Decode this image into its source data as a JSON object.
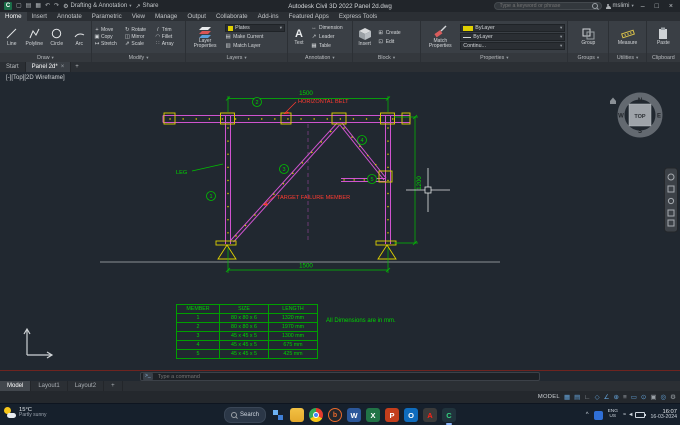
{
  "titlebar": {
    "app_title": "Autodesk Civil 3D 2022   Panel 2d.dwg",
    "workspace": "Drafting & Annotation",
    "share_label": "Share",
    "search_placeholder": "Type a keyword or phrase",
    "username": "mslimi"
  },
  "ribbon": {
    "tabs": [
      "Home",
      "Insert",
      "Annotate",
      "Parametric",
      "View",
      "Manage",
      "Output",
      "Collaborate",
      "Add-ins",
      "Featured Apps",
      "Express Tools"
    ],
    "draw": {
      "label": "Draw",
      "tools": [
        "Line",
        "Polyline",
        "Circle",
        "Arc"
      ]
    },
    "modify": {
      "label": "Modify",
      "tools": [
        "Move",
        "Rotate",
        "Trim",
        "Copy",
        "Mirror",
        "Fillet",
        "Stretch",
        "Scale",
        "Array"
      ]
    },
    "layers": {
      "label": "Layers",
      "main": "Layer Properties",
      "current_layer": "Plates",
      "make_current": "Make Current",
      "match_layer": "Match Layer"
    },
    "annotation": {
      "label": "Annotation",
      "main": "Text",
      "tools": [
        "Dimension",
        "Leader",
        "Table"
      ]
    },
    "block": {
      "label": "Block",
      "main": "Insert",
      "tools": [
        "Create",
        "Edit"
      ]
    },
    "properties": {
      "label": "Properties",
      "main": "Match Properties",
      "dropdowns": [
        "ByLayer",
        "ByLayer",
        "Continu..."
      ]
    },
    "groups": {
      "label": "Groups",
      "main": "Group"
    },
    "utilities": {
      "label": "Utilities",
      "main": "Measure"
    },
    "clipboard": {
      "label": "Clipboard",
      "main": "Paste"
    }
  },
  "filetabs": {
    "start": "Start",
    "active": "Panel 2d*",
    "new_tab": "+"
  },
  "canvas": {
    "viewport_label": "[-][Top][2D Wireframe]",
    "dims": {
      "top": "1500",
      "bottom": "1500",
      "right": "1200"
    },
    "labels": {
      "belt": "HORIZONTAL BELT",
      "leg": "LEG",
      "target": "TARGET FAILURE MEMBER"
    },
    "markers": [
      "1",
      "2",
      "3",
      "4",
      "5"
    ],
    "note": "All Dimensions are in mm.",
    "viewcube": {
      "top": "TOP",
      "n": "N",
      "e": "E",
      "s": "S",
      "w": "W"
    }
  },
  "member_table": {
    "headers": [
      "MEMBER",
      "SIZE",
      "LENGTH"
    ],
    "rows": [
      [
        "1",
        "80 x 80 x 6",
        "1320 mm"
      ],
      [
        "2",
        "80 x 80 x 6",
        "1970 mm"
      ],
      [
        "3",
        "45 x 45 x 5",
        "1300 mm"
      ],
      [
        "4",
        "45 x 45 x 5",
        "675 mm"
      ],
      [
        "5",
        "45 x 45 x 5",
        "425 mm"
      ]
    ]
  },
  "command_bar": {
    "placeholder": "Type a command"
  },
  "layout_bar": {
    "tabs": [
      "Model",
      "Layout1",
      "Layout2"
    ],
    "new_tab": "+"
  },
  "statusbar": {
    "model_label": "MODEL"
  },
  "taskbar": {
    "weather_temp": "15°C",
    "weather_desc": "Partly sunny",
    "search_label": "Search",
    "lang_line1": "ENG",
    "lang_line2": "US",
    "time": "16:07",
    "date": "16-03-2024"
  }
}
